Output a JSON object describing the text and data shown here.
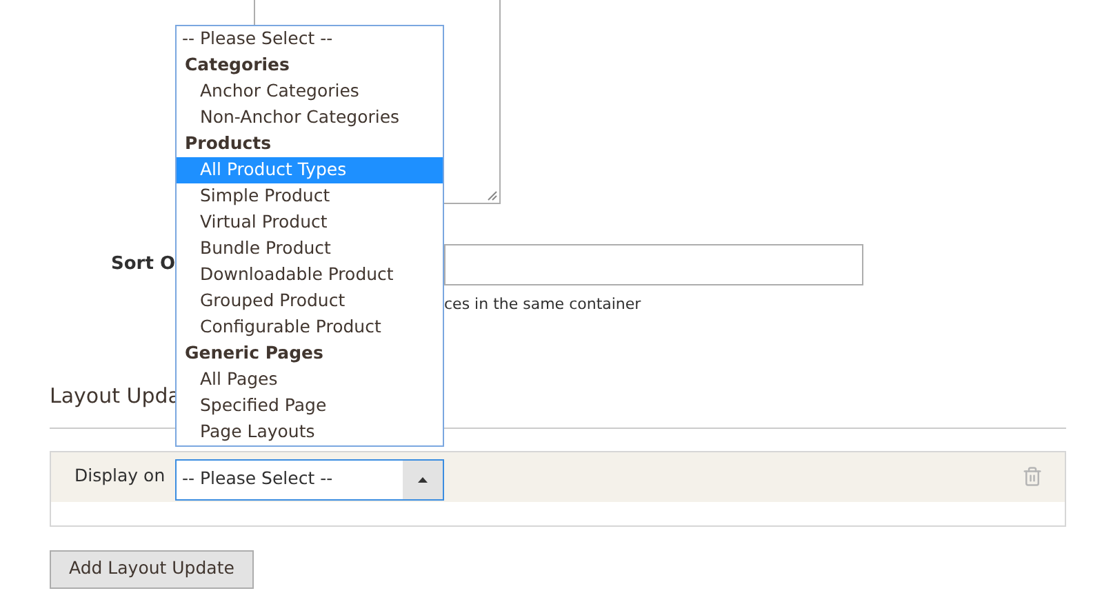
{
  "sort_order": {
    "label": "Sort O"
  },
  "note": "ces in the same container",
  "section_title": "Layout Upda",
  "layout_update": {
    "label": "Display on",
    "select": {
      "value": "-- Please Select --",
      "expanded": true
    }
  },
  "dropdown": {
    "items": [
      {
        "kind": "blank",
        "label": "-- Please Select --",
        "selected": false
      },
      {
        "kind": "group",
        "label": "Categories",
        "selected": false
      },
      {
        "kind": "option",
        "label": "Anchor Categories",
        "selected": false
      },
      {
        "kind": "option",
        "label": "Non-Anchor Categories",
        "selected": false
      },
      {
        "kind": "group",
        "label": "Products",
        "selected": false
      },
      {
        "kind": "option",
        "label": "All Product Types",
        "selected": true
      },
      {
        "kind": "option",
        "label": "Simple Product",
        "selected": false
      },
      {
        "kind": "option",
        "label": "Virtual Product",
        "selected": false
      },
      {
        "kind": "option",
        "label": "Bundle Product",
        "selected": false
      },
      {
        "kind": "option",
        "label": "Downloadable Product",
        "selected": false
      },
      {
        "kind": "option",
        "label": "Grouped Product",
        "selected": false
      },
      {
        "kind": "option",
        "label": "Configurable Product",
        "selected": false
      },
      {
        "kind": "group",
        "label": "Generic Pages",
        "selected": false
      },
      {
        "kind": "option",
        "label": "All Pages",
        "selected": false
      },
      {
        "kind": "option",
        "label": "Specified Page",
        "selected": false
      },
      {
        "kind": "option",
        "label": "Page Layouts",
        "selected": false
      }
    ]
  },
  "add_button": "Add Layout Update"
}
